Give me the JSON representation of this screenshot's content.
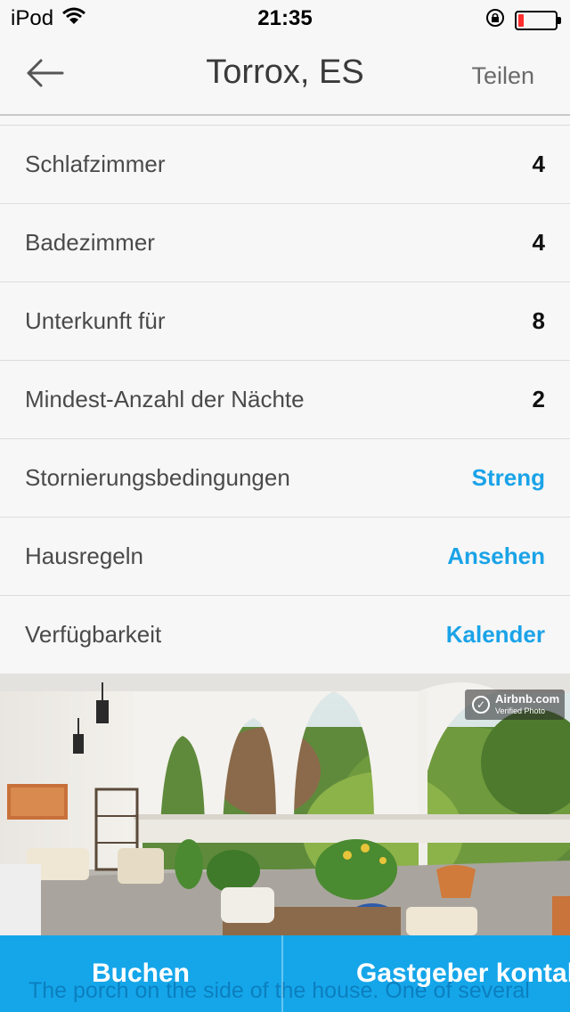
{
  "status_bar": {
    "carrier": "iPod",
    "time": "21:35",
    "battery_level": 0.15
  },
  "nav": {
    "title": "Torrox, ES",
    "share_label": "Teilen"
  },
  "details": [
    {
      "label": "Schlafzimmer",
      "value": "4",
      "link": false
    },
    {
      "label": "Badezimmer",
      "value": "4",
      "link": false
    },
    {
      "label": "Unterkunft für",
      "value": "8",
      "link": false
    },
    {
      "label": "Mindest-Anzahl der Nächte",
      "value": "2",
      "link": false
    },
    {
      "label": "Stornierungsbedingungen",
      "value": "Streng",
      "link": true
    },
    {
      "label": "Hausregeln",
      "value": "Ansehen",
      "link": true
    },
    {
      "label": "Verfügbarkeit",
      "value": "Kalender",
      "link": true
    }
  ],
  "photo": {
    "badge_brand": "Airbnb.com",
    "badge_sub": "Verified Photo",
    "caption": "The porch on the side of the house. One of several"
  },
  "actions": {
    "book_label": "Buchen",
    "contact_label": "Gastgeber kontaktieren"
  },
  "colors": {
    "accent": "#1aa3e8",
    "bottom_bar": "#15a6ea",
    "battery_low": "#ff2d2d"
  }
}
